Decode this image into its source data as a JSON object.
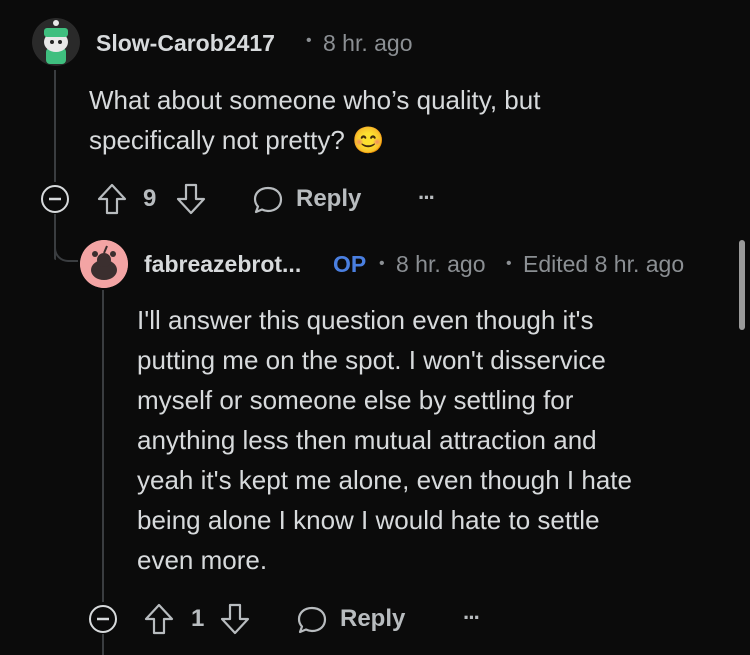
{
  "comment1": {
    "username": "Slow-Carob2417",
    "dot": "•",
    "time": "8 hr. ago",
    "body": "What about someone who’s quality, but specifically not pretty? 😊",
    "votes": "9",
    "reply_label": "Reply",
    "more": "···"
  },
  "comment2": {
    "username": "fabreazebrot...",
    "op_badge": "OP",
    "dot": "•",
    "time": "8 hr. ago",
    "dot2": "•",
    "edited": "Edited 8 hr. ago",
    "body_lines": [
      "I'll answer this question even though it's",
      "putting me on the spot. I won't disservice",
      "myself or someone else by settling for",
      "anything less then mutual attraction and",
      "yeah it's kept me alone, even though I hate",
      "being alone I know I would hate to settle",
      "even more."
    ],
    "votes": "1",
    "reply_label": "Reply",
    "more": "···"
  },
  "colors": {
    "background": "#0b0b0b",
    "op": "#4a7fe0",
    "avatar2_bg": "#f3a4a4"
  }
}
